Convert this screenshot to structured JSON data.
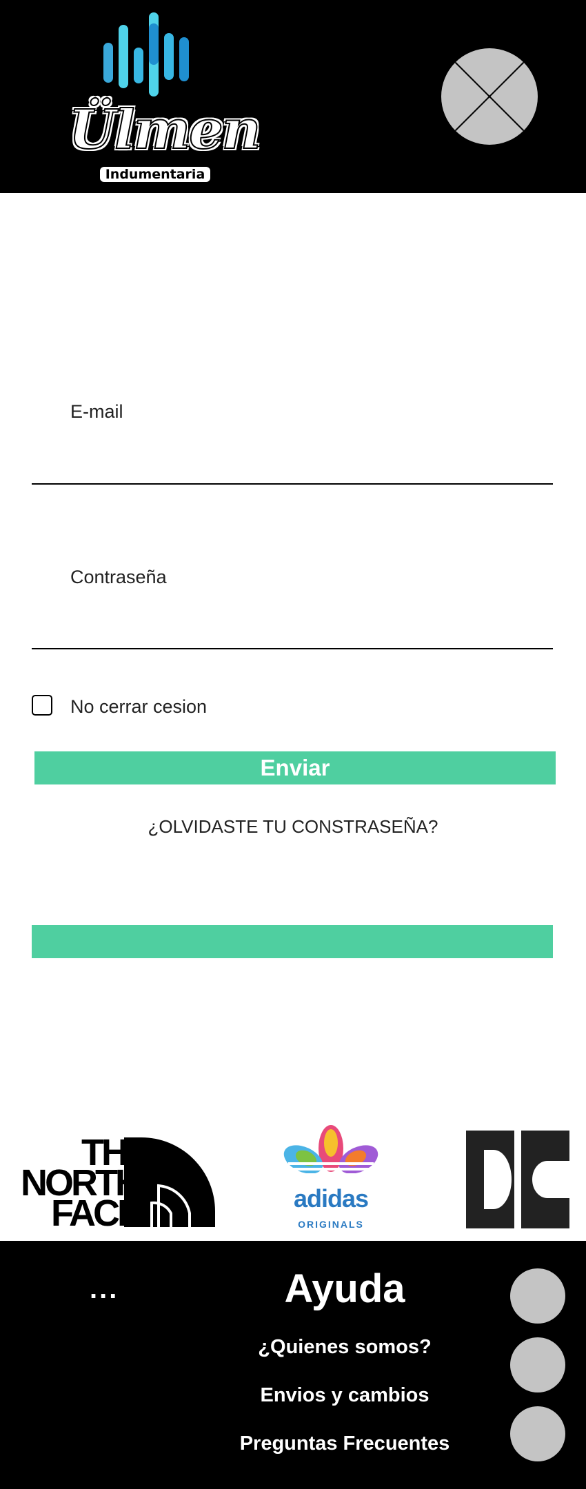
{
  "brand": {
    "logo_name": "Ülmen",
    "logo_subtitle": "Indumentaria",
    "bar_colors": [
      "#1f8fd0",
      "#38b7e3",
      "#4fd3ea",
      "#1f8fd0",
      "#3aa8da"
    ]
  },
  "header": {
    "close_icon": "close-x-icon"
  },
  "login_form": {
    "email_label": "E-mail",
    "password_label": "Contraseña",
    "remember_label": "No cerrar cesion",
    "remember_checked": false,
    "submit_label": "Enviar",
    "forgot_link": "¿OLVIDASTE TU CONSTRASEÑA?"
  },
  "brands": {
    "items": [
      "THE NORTH FACE",
      "adidas ORIGINALS",
      "DC"
    ],
    "tnf_line1": "THE",
    "tnf_line2": "NORTH",
    "tnf_line3": "FACE",
    "adidas_word": "adidas",
    "adidas_sub": "ORIGINALS"
  },
  "footer": {
    "more_label": "...",
    "title": "Ayuda",
    "links": [
      "¿Quienes somos?",
      "Envios y cambios",
      "Preguntas Frecuentes"
    ],
    "social_icons": [
      "social-placeholder-icon",
      "social-placeholder-icon",
      "social-placeholder-icon"
    ]
  },
  "colors": {
    "accent": "#4fcfa0",
    "header_bg": "#000000",
    "placeholder_gray": "#c4c4c4"
  }
}
